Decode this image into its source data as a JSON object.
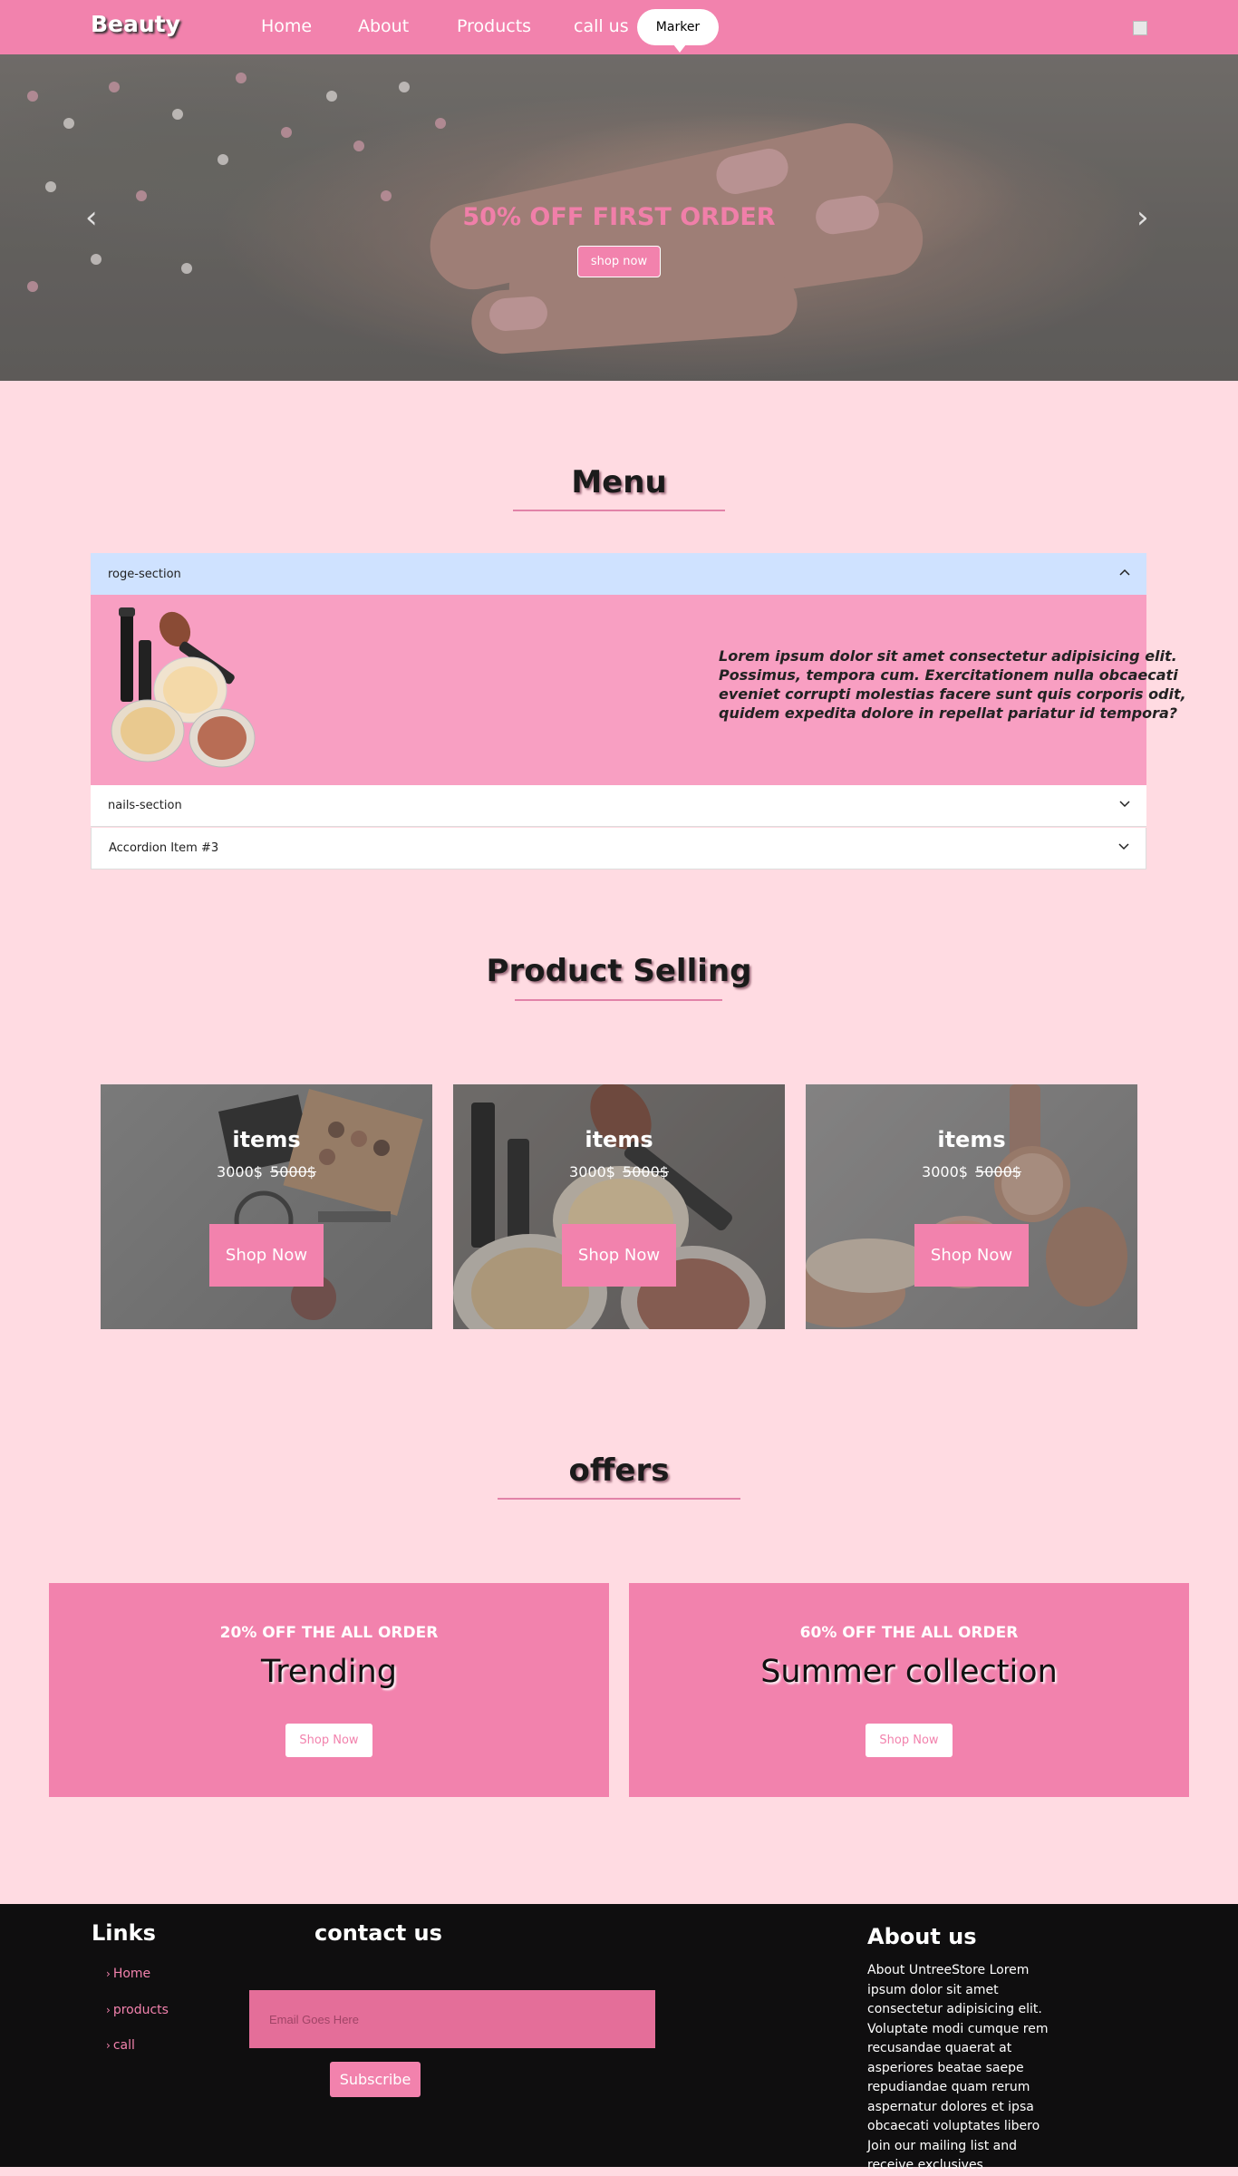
{
  "nav": {
    "brand": "Beauty",
    "links": [
      "Home",
      "About",
      "Products",
      "call us"
    ],
    "marker": "Marker"
  },
  "hero": {
    "title": "50% OFF FIRST ORDER",
    "button": "shop now"
  },
  "menu": {
    "title": "Menu",
    "items": [
      {
        "label": "roge-section",
        "expanded": true
      },
      {
        "label": "nails-section",
        "expanded": false
      },
      {
        "label": "Accordion Item #3",
        "expanded": false
      }
    ],
    "body_text": "Lorem ipsum dolor sit amet consectetur adipisicing elit. Possimus, tempora cum. Exercitationem nulla obcaecati eveniet corrupti molestias facere sunt quis corporis odit, quidem expedita dolore in repellat pariatur id tempora?"
  },
  "products": {
    "title": "Product Selling",
    "cards": [
      {
        "title": "items",
        "price": "3000$",
        "old_price": "5000$",
        "button": "Shop Now"
      },
      {
        "title": "items",
        "price": "3000$",
        "old_price": "5000$",
        "button": "Shop Now"
      },
      {
        "title": "items",
        "price": "3000$",
        "old_price": "5000$",
        "button": "Shop Now"
      }
    ]
  },
  "offers": {
    "title": "offers",
    "cards": [
      {
        "kicker": "20% OFF THE ALL ORDER",
        "title": "Trending",
        "button": "Shop Now"
      },
      {
        "kicker": "60% OFF THE ALL ORDER",
        "title": "Summer collection",
        "button": "Shop Now"
      }
    ]
  },
  "footer": {
    "links_heading": "Links",
    "links": [
      "Home",
      "products",
      "call"
    ],
    "contact_heading": "contact us",
    "email_placeholder": "Email Goes Here",
    "subscribe": "Subscribe",
    "about_heading": "About us",
    "about_text": "About UntreeStore Lorem ipsum dolor sit amet consectetur adipisicing elit. Voluptate modi cumque rem recusandae quaerat at asperiores beatae saepe repudiandae quam rerum aspernatur dolores et ipsa obcaecati voluptates libero Join our mailing list and receive exclusives"
  },
  "colors": {
    "accent": "#f282ad",
    "page_bg": "#ffdbe2",
    "accordion_active": "#cfe2ff",
    "footer_bg": "#0f0e0f"
  },
  "icons": {
    "carousel_prev": "chevron-left-icon",
    "carousel_next": "chevron-right-icon",
    "accordion_open": "chevron-up-icon",
    "accordion_closed": "chevron-down-icon"
  }
}
